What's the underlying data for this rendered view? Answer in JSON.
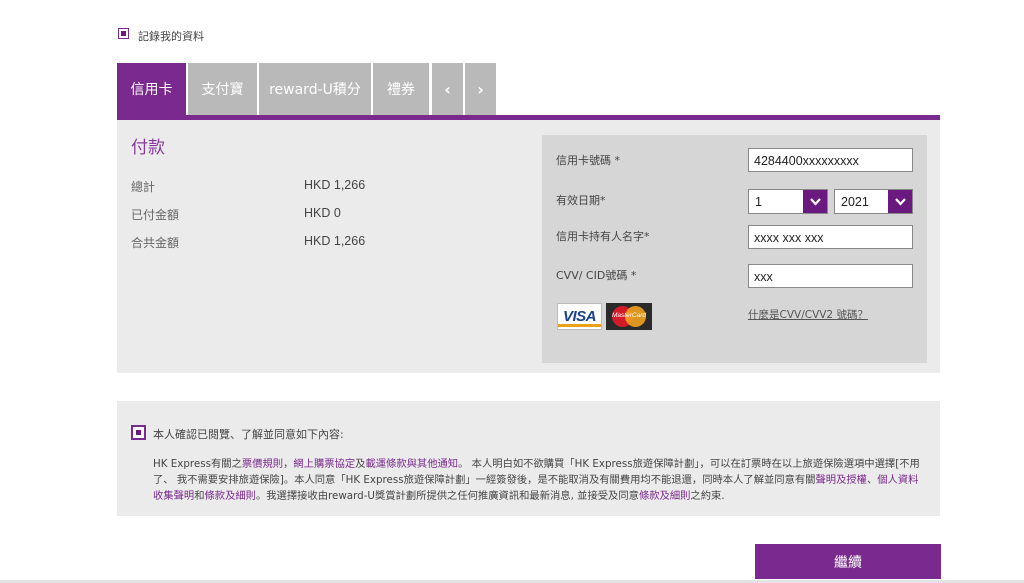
{
  "remember": {
    "label": "記錄我的資料",
    "checked": true
  },
  "tabs": [
    {
      "label": "信用卡",
      "active": true
    },
    {
      "label": "支付寶",
      "active": false
    },
    {
      "label": "reward-U積分",
      "active": false
    },
    {
      "label": "禮券",
      "active": false
    }
  ],
  "tab_nav": {
    "prev": "‹",
    "next": "›"
  },
  "payment": {
    "title": "付款",
    "rows": [
      {
        "label": "總計",
        "value": "HKD 1,266"
      },
      {
        "label": "已付金額",
        "value": "HKD 0"
      },
      {
        "label": "合共金額",
        "value": "HKD 1,266"
      }
    ]
  },
  "card_form": {
    "number_label": "信用卡號碼 *",
    "number_value": "4284400xxxxxxxxx",
    "expiry_label": "有效日期*",
    "expiry_month": "1",
    "expiry_year": "2021",
    "holder_label": "信用卡持有人名字*",
    "holder_value": "xxxx xxx xxx",
    "cvv_label": "CVV/ CID號碼 *",
    "cvv_value": "xxx",
    "cvv_help": "什麼是CVV/CVV2 號碼？",
    "visa_text": "VISA",
    "mastercard_text": "MasterCard"
  },
  "terms": {
    "checked": true,
    "title": "本人確認已閱覽、了解並同意如下內容:",
    "p1": "HK Express有關之",
    "link_fare_rules": "票價規則",
    "sep1": "，",
    "link_online": "網上購票協定",
    "p2": "及",
    "link_carriage": "載運條款與其他通知",
    "p3": "。 本人明白如不欲購買「HK Express旅遊保障計劃」，可以在訂票時在以上旅遊保險選項中選擇[不用了、 我不需要安排旅遊保險]。本人同意「HK Express旅遊保障計劃」一經簽發後，是不能取消及有關費用均不能退還，同時本人了解並同意有關",
    "link_declaration": "聲明及授權",
    "p4": "、",
    "link_privacy": "個人資料收集聲明",
    "p5": "和",
    "link_terms1": "條款及細則",
    "p6": "。我選擇接收由reward-U獎賞計劃所提供之任何推廣資訊和最新消息, 並接受及同意",
    "link_terms2": "條款及細則",
    "p7": "之約束."
  },
  "continue_label": "繼續",
  "colors": {
    "brand_purple": "#7a2a8e",
    "tab_gray": "#b9b9b9",
    "panel_gray": "#ebebeb"
  }
}
